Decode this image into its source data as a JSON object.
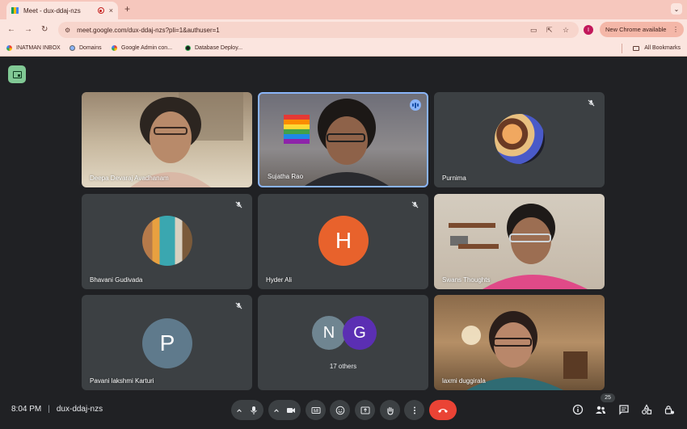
{
  "browser": {
    "tab_title": "Meet - dux-ddaj-nzs",
    "new_tab_symbol": "+",
    "tab_close_symbol": "×",
    "url": "meet.google.com/dux-ddaj-nzs?pli=1&authuser=1",
    "profile_initial": "I",
    "update_label": "New Chrome available",
    "menu_symbol": "⋮",
    "bookmarks": [
      {
        "label": "INATMAN INBOX",
        "icon": "google-icon"
      },
      {
        "label": "Domains",
        "icon": "globe-icon"
      },
      {
        "label": "Google Admin con...",
        "icon": "google-icon"
      },
      {
        "label": "Database Deploy...",
        "icon": "database-icon"
      }
    ],
    "all_bookmarks_label": "All Bookmarks"
  },
  "meet": {
    "tiles": [
      {
        "name": "Deepa Devaraj Avadhanam",
        "kind": "video",
        "muted": false
      },
      {
        "name": "Sujatha Rao",
        "kind": "video",
        "speaking": true
      },
      {
        "name": "Purnima",
        "kind": "photo",
        "muted": true
      },
      {
        "name": "Bhavani Gudivada",
        "kind": "photo",
        "muted": true
      },
      {
        "name": "Hyder Ali",
        "kind": "initial",
        "initial": "H",
        "color": "#e8622c",
        "muted": true
      },
      {
        "name": "Swans Thoughts",
        "kind": "video",
        "muted": false
      },
      {
        "name": "Pavani lakshmi Karturi",
        "kind": "initial",
        "initial": "P",
        "color": "#5f7a8c",
        "muted": true
      },
      {
        "name": "17 others",
        "kind": "group",
        "initials": [
          "N",
          "G"
        ],
        "colors": [
          "#6f8591",
          "#5b2fb3"
        ]
      },
      {
        "name": "laxmi duggirala",
        "kind": "video",
        "muted": false
      }
    ],
    "clock": "8:04 PM",
    "separator": "|",
    "meeting_code": "dux-ddaj-nzs",
    "participant_count": "25",
    "colors": {
      "accent": "#8ab4f8",
      "hangup": "#ea4335",
      "control_bg": "#3c4043",
      "background": "#202124"
    }
  }
}
